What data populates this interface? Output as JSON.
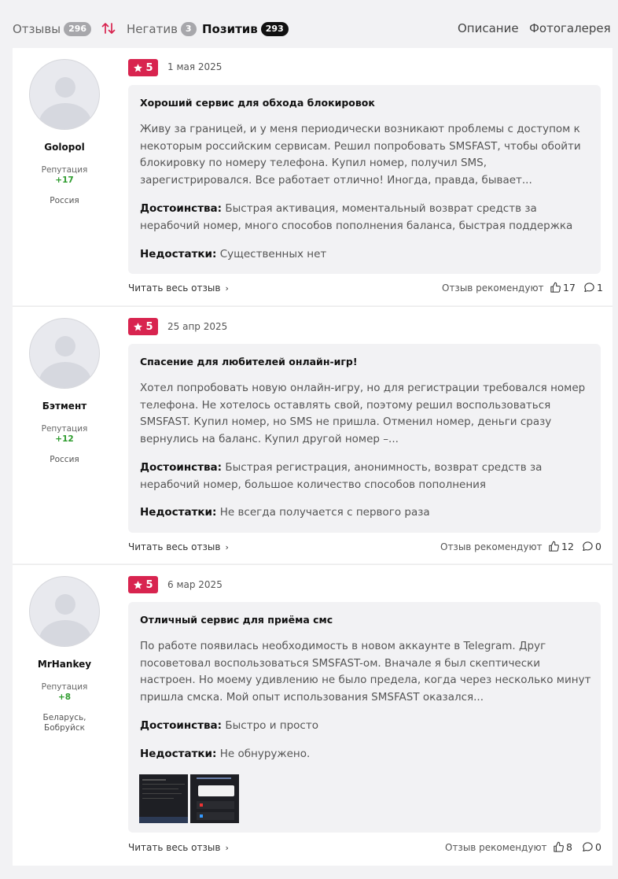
{
  "tabs": {
    "reviews": {
      "label": "Отзывы",
      "count": "296"
    },
    "negative": {
      "label": "Негатив",
      "count": "3"
    },
    "positive": {
      "label": "Позитив",
      "count": "293"
    },
    "description": "Описание",
    "gallery": "Фотогалерея"
  },
  "labels": {
    "reputation": "Репутация",
    "pros": "Достоинства:",
    "cons": "Недостатки:",
    "read_more": "Читать весь отзыв",
    "recommend": "Отзыв рекомендуют"
  },
  "colors": {
    "rating_badge": "#d8244f",
    "reputation": "#2e9c2e",
    "active_badge": "#111111"
  },
  "reviews": [
    {
      "author": "Golopol",
      "reputation": "+17",
      "location": "Россия",
      "rating": "5",
      "date": "1 мая 2025",
      "title": "Хороший сервис для обхода блокировок",
      "text": "Живу за границей, и у меня периодически возникают проблемы с доступом к некоторым российским сервисам. Решил попробовать SMSFAST, чтобы обойти блокировку по номеру телефона. Купил номер, получил SMS, зарегистрировался. Все работает отлично! Иногда, правда, бывает...",
      "pros": "Быстрая активация, моментальный возврат средств за нерабочий номер, много способов пополнения баланса, быстрая поддержка",
      "cons": "Существенных нет",
      "likes": "17",
      "comments": "1"
    },
    {
      "author": "Бэтмент",
      "reputation": "+12",
      "location": "Россия",
      "rating": "5",
      "date": "25 апр 2025",
      "title": "Спасение для любителей онлайн-игр!",
      "text": "Хотел попробовать новую онлайн-игру, но для регистрации требовался номер телефона. Не хотелось оставлять свой, поэтому решил воспользоваться SMSFAST. Купил номер, но SMS не пришла. Отменил номер, деньги сразу вернулись на баланс. Купил другой номер –...",
      "pros": "Быстрая регистрация, анонимность, возврат средств за нерабочий номер, большое количество способов пополнения",
      "cons": "Не всегда получается с первого раза",
      "likes": "12",
      "comments": "0"
    },
    {
      "author": "MrHankey",
      "reputation": "+8",
      "location": "Беларусь, Бобруйск",
      "rating": "5",
      "date": "6 мар 2025",
      "title": "Отличный сервис для приёма смс",
      "text": "По работе появилась необходимость в новом аккаунте в Telegram. Друг посоветовал воспользоваться SMSFAST-ом. Вначале я был скептически настроен. Но моему удивлению не было предела, когда через несколько минут пришла смска. Мой опыт использования SMSFAST оказался...",
      "pros": "Быстро и просто",
      "cons": "Не обнуружено.",
      "likes": "8",
      "comments": "0"
    }
  ]
}
